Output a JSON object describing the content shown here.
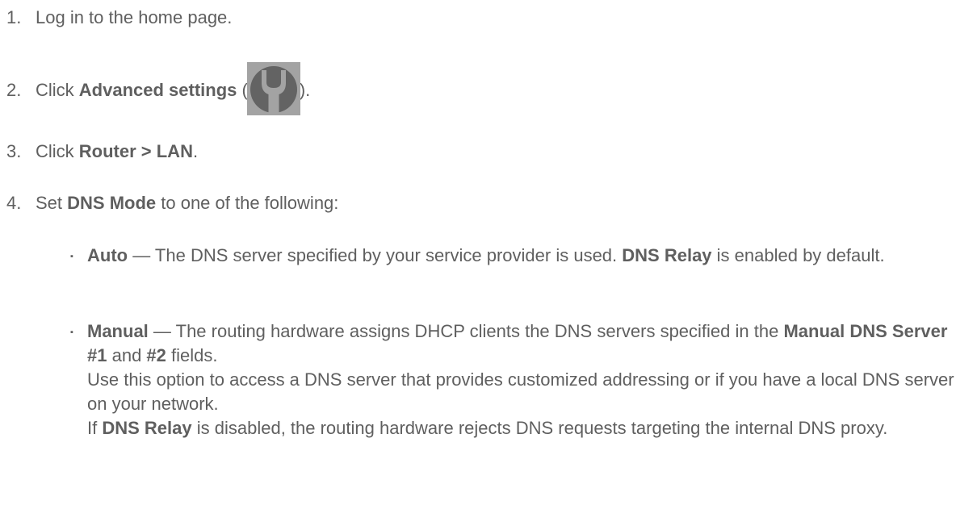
{
  "steps": [
    {
      "num": "1.",
      "pre": "Log in to the home page."
    },
    {
      "num": "2.",
      "pre": "Click ",
      "bold": "Advanced settings",
      "mid": " (",
      "post": ").",
      "icon": "wrench-icon"
    },
    {
      "num": "3.",
      "pre": "Click ",
      "bold": "Router > LAN",
      "post": "."
    },
    {
      "num": "4.",
      "pre": "Set ",
      "bold": "DNS Mode",
      "post": " to one of the following:"
    }
  ],
  "bullets": [
    {
      "mark": "▪",
      "term": "Auto",
      "t1": " — The DNS server specified by your service provider is used. ",
      "b1": "DNS Relay",
      "t2": " is enabled by default."
    },
    {
      "mark": "▪",
      "term": "Manual",
      "t1": " — The routing hardware assigns DHCP clients the DNS servers specified in the ",
      "b1": "Manual DNS Server #1",
      "t2": " and ",
      "b2": "#2",
      "t3": " fields.",
      "p2": "Use this option to access a DNS server that provides customized addressing or if you have a local DNS server on your network.",
      "p3_pre": "If ",
      "p3_bold": "DNS Relay",
      "p3_post": " is disabled, the routing hardware rejects DNS requests targeting the internal DNS proxy."
    }
  ]
}
